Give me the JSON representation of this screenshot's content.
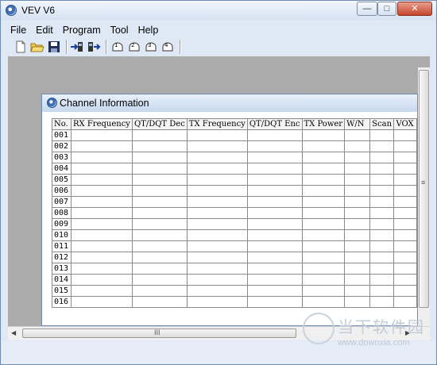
{
  "window": {
    "title": "VEV V6",
    "minimize": "—",
    "maximize": "□",
    "close": "✕"
  },
  "menu": [
    "File",
    "Edit",
    "Program",
    "Tool",
    "Help"
  ],
  "toolbar": {
    "icons": [
      "new-file-icon",
      "open-folder-icon",
      "save-icon",
      "read-from-radio-icon",
      "write-to-radio-icon",
      "hand-tool-1-icon",
      "hand-tool-2-icon",
      "hand-tool-3-icon",
      "hand-tool-4-icon"
    ],
    "hand_labels": [
      "1",
      "2",
      "3",
      "4"
    ]
  },
  "channel_window": {
    "title": "Channel Information",
    "columns": [
      "No.",
      "RX Frequency",
      "QT/DQT Dec",
      "TX Frequency",
      "QT/DQT Enc",
      "TX Power",
      "W/N",
      "Scan",
      "VOX"
    ],
    "rows": [
      "001",
      "002",
      "003",
      "004",
      "005",
      "006",
      "007",
      "008",
      "009",
      "010",
      "011",
      "012",
      "013",
      "014",
      "015",
      "016"
    ]
  },
  "scrollbar": {
    "h_grip": "III",
    "v_grip": "≡"
  },
  "watermark": {
    "brand": "当下软件园",
    "url": "www.downxia.com"
  }
}
